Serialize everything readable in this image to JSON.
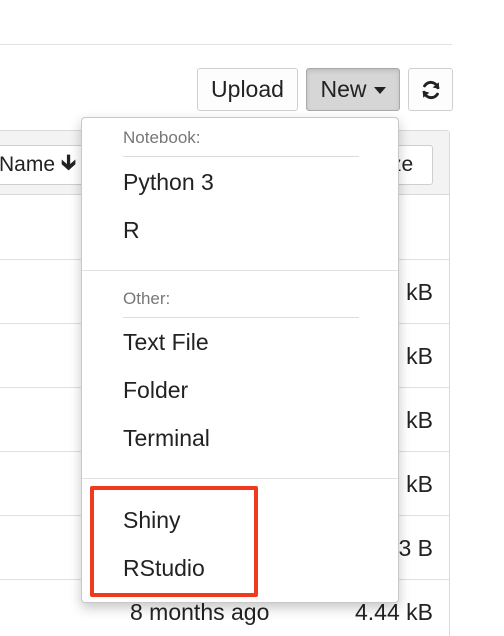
{
  "toolbar": {
    "upload_label": "Upload",
    "new_label": "New",
    "refresh_icon": "refresh-icon"
  },
  "list_header": {
    "name_label": "Name",
    "name_sort_icon": "arrow-down-icon",
    "size_label_partial": "ze"
  },
  "rows": [
    {
      "modified": "",
      "size": "kB"
    },
    {
      "modified": "",
      "size": "kB"
    },
    {
      "modified": "",
      "size": "kB"
    },
    {
      "modified": "",
      "size": "kB"
    },
    {
      "modified": "",
      "size": "3 B"
    },
    {
      "modified": "8 months ago",
      "size": "4.44 kB"
    }
  ],
  "new_menu": {
    "notebook_header": "Notebook:",
    "notebook_items": [
      "Python 3",
      "R"
    ],
    "other_header": "Other:",
    "other_items": [
      "Text File",
      "Folder",
      "Terminal"
    ],
    "extra_items": [
      "Shiny",
      "RStudio"
    ]
  },
  "colors": {
    "highlight": "#f03a1e",
    "active_button": "#d6d6d6"
  }
}
